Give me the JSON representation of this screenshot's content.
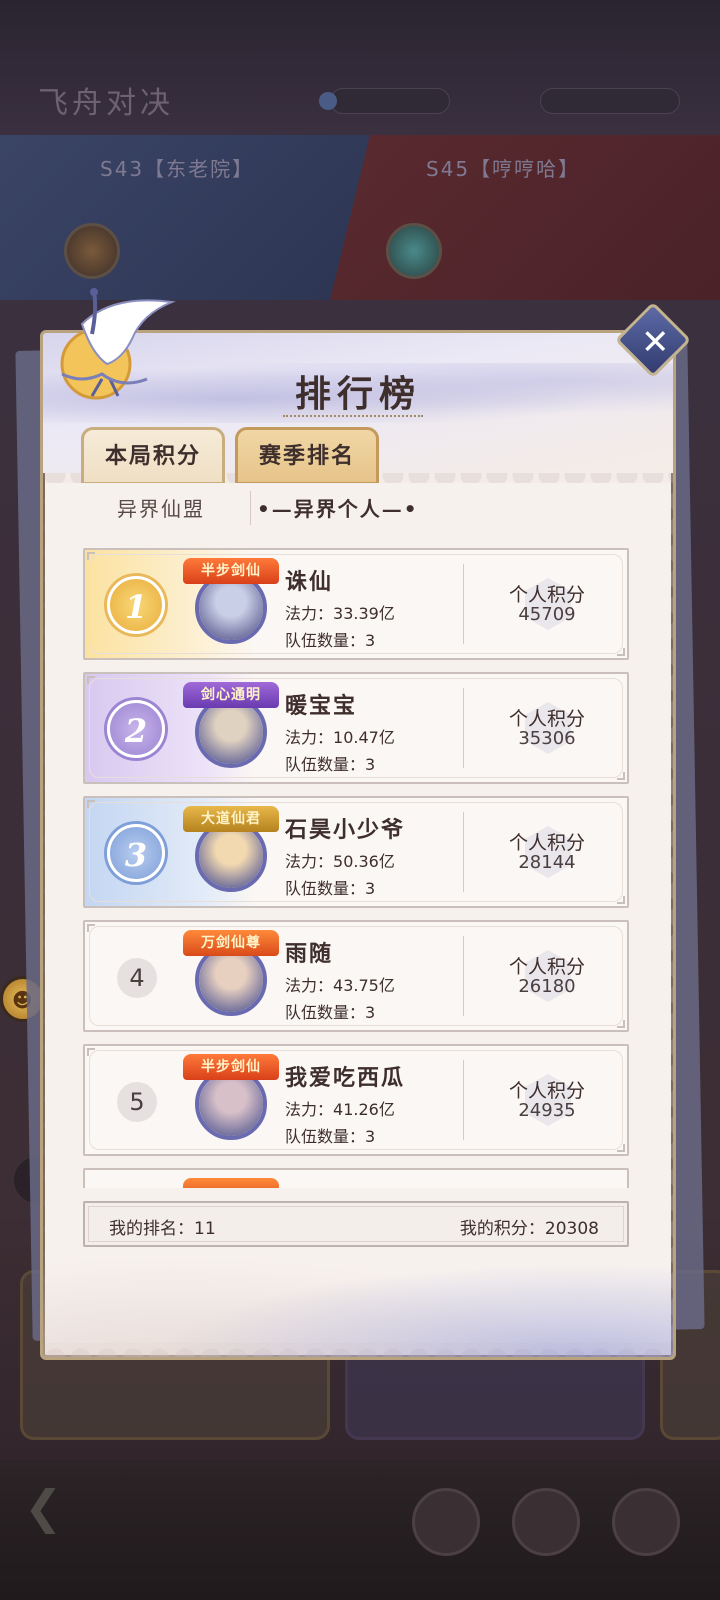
{
  "background": {
    "title": "飞舟对决",
    "left_team": "S43【东老院】",
    "right_team": "S45【哼哼哈】"
  },
  "modal": {
    "title": "排行榜",
    "tabs": [
      "本局积分",
      "赛季排名"
    ],
    "subtabs": [
      "异界仙盟",
      "异界个人"
    ],
    "score_label": "个人积分",
    "power_label": "法力：",
    "team_label": "队伍数量：",
    "rows": [
      {
        "rank": "1",
        "badge": "半步剑仙",
        "name": "诛仙",
        "power": "33.39亿",
        "teams": "3",
        "score": "45709"
      },
      {
        "rank": "2",
        "badge": "剑心通明",
        "name": "暖宝宝",
        "power": "10.47亿",
        "teams": "3",
        "score": "35306"
      },
      {
        "rank": "3",
        "badge": "大道仙君",
        "name": "石昊小少爷",
        "power": "50.36亿",
        "teams": "3",
        "score": "28144"
      },
      {
        "rank": "4",
        "badge": "万剑仙尊",
        "name": "雨随",
        "power": "43.75亿",
        "teams": "3",
        "score": "26180"
      },
      {
        "rank": "5",
        "badge": "半步剑仙",
        "name": "我爱吃西瓜",
        "power": "41.26亿",
        "teams": "3",
        "score": "24935"
      }
    ],
    "my_rank_label": "我的排名：",
    "my_rank": "11",
    "my_score_label": "我的积分：",
    "my_score": "20308"
  },
  "colors": {
    "gold": "#f2c45a",
    "purple": "#a893d8",
    "blue": "#8fb0e0"
  }
}
